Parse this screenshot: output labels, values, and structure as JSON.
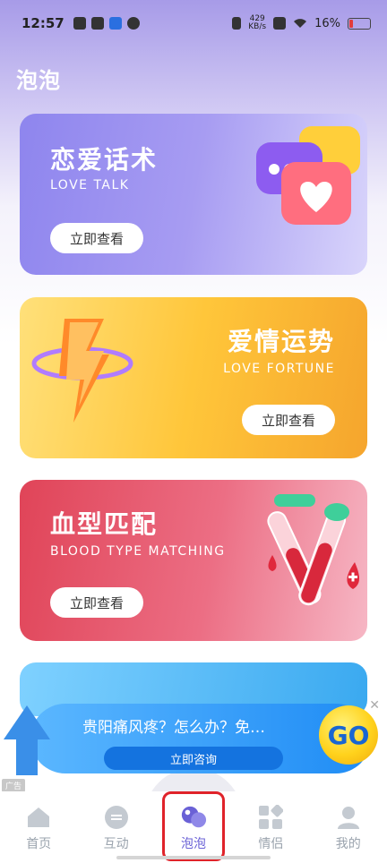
{
  "status_bar": {
    "time": "12:57",
    "network_speed_value": "429",
    "network_speed_unit": "KB/s",
    "battery": "16%"
  },
  "page": {
    "title": "泡泡"
  },
  "cards": [
    {
      "title": "恋爱话术",
      "subtitle": "LOVE TALK",
      "button": "立即查看"
    },
    {
      "title": "爱情运势",
      "subtitle": "LOVE FORTUNE",
      "button": "立即查看"
    },
    {
      "title": "血型匹配",
      "subtitle": "BLOOD TYPE MATCHING",
      "button": "立即查看"
    }
  ],
  "ad": {
    "text": "贵阳痛风疼？怎么办？免…",
    "button": "立即咨询",
    "go": "GO",
    "tag": "广告"
  },
  "tabs": [
    {
      "label": "首页",
      "icon": "home-icon"
    },
    {
      "label": "互动",
      "icon": "chat-icon"
    },
    {
      "label": "泡泡",
      "icon": "bubbles-icon"
    },
    {
      "label": "情侣",
      "icon": "grid-icon"
    },
    {
      "label": "我的",
      "icon": "user-icon"
    }
  ],
  "colors": {
    "accent": "#6a61d6",
    "love": "#8e85ee",
    "fortune": "#ffc63a",
    "blood": "#e04458",
    "ad": "#1f8cf5"
  }
}
